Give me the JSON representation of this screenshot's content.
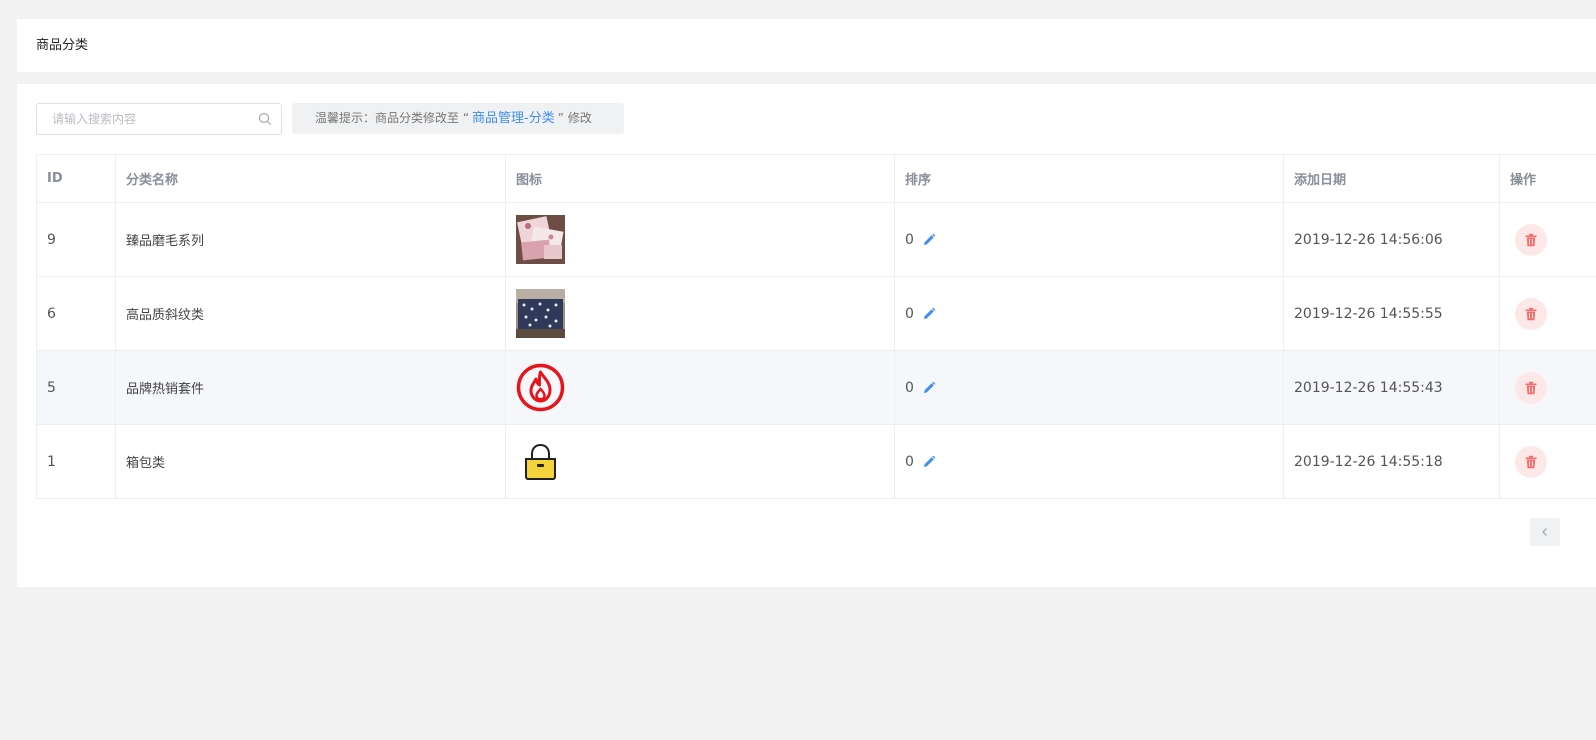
{
  "page": {
    "title": "商品分类"
  },
  "search": {
    "placeholder": "请输入搜索内容",
    "value": ""
  },
  "tip": {
    "prefix": "温馨提示：商品分类修改至 “",
    "link": "商品管理-分类",
    "suffix": "” 修改"
  },
  "table": {
    "columns": [
      "ID",
      "分类名称",
      "图标",
      "排序",
      "添加日期",
      "操作"
    ],
    "rows": [
      {
        "id": "9",
        "name": "臻品磨毛系列",
        "icon": "bedding-photo-pink",
        "sort": "0",
        "date": "2019-12-26 14:56:06"
      },
      {
        "id": "6",
        "name": "高品质斜纹类",
        "icon": "bedding-photo-navy",
        "sort": "0",
        "date": "2019-12-26 14:55:55"
      },
      {
        "id": "5",
        "name": "品牌热销套件",
        "icon": "fire-icon",
        "sort": "0",
        "date": "2019-12-26 14:55:43"
      },
      {
        "id": "1",
        "name": "箱包类",
        "icon": "handbag-icon",
        "sort": "0",
        "date": "2019-12-26 14:55:18"
      }
    ]
  },
  "colors": {
    "accent": "#3f8ef0",
    "danger": "#f56c6c",
    "danger_bg": "#fde8e8",
    "hover_row": "#f5f7fa"
  },
  "icons": {
    "search": "search-icon",
    "edit": "pencil-icon",
    "delete": "trash-icon",
    "pager": "chevron-left-icon"
  }
}
